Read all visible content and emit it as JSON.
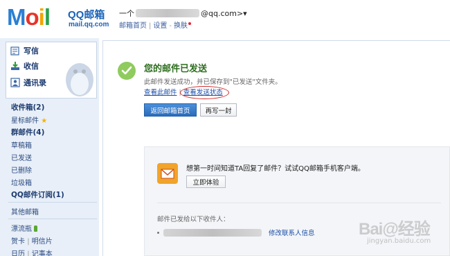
{
  "header": {
    "logo_brand": "QQ邮箱",
    "logo_url": "mail.qq.com",
    "user_prefix": "一个",
    "user_suffix": "@qq.com>▾",
    "links": [
      "邮箱首页",
      "设置",
      "换肤"
    ]
  },
  "sidebar": {
    "actions": [
      {
        "label": "写信",
        "icon": "compose-icon"
      },
      {
        "label": "收信",
        "icon": "inbox-download-icon"
      },
      {
        "label": "通讯录",
        "icon": "contacts-icon"
      }
    ],
    "folders": [
      {
        "label": "收件箱(2)",
        "bold": true
      },
      {
        "label": "星标邮件",
        "bold": false
      },
      {
        "label": "群邮件(4)",
        "bold": true
      },
      {
        "label": "草稿箱",
        "bold": false
      },
      {
        "label": "已发送",
        "bold": false
      },
      {
        "label": "已删除",
        "bold": false
      },
      {
        "label": "垃圾箱",
        "bold": false
      },
      {
        "label": "QQ邮件订阅(1)",
        "bold": true
      }
    ],
    "other_mailbox": "其他邮箱",
    "drift_bottle": "漂流瓶",
    "card": "贺卡",
    "postcard": "明信片",
    "calendar": "日历",
    "notebook": "记事本"
  },
  "main": {
    "title": "您的邮件已发送",
    "desc": "此邮件发送成功，并已保存到\"已发送\"文件夹。",
    "view_link": "查看此邮件",
    "status_link": "查看发送状态",
    "back_button": "返回邮箱首页",
    "write_again_button": "再写一封",
    "promo_text": "想第一时间知道TA回复了邮件？试试QQ邮箱手机客户端。",
    "try_button": "立即体验",
    "recipients_label": "邮件已发给以下收件人：",
    "edit_contact": "修改联系人信息"
  },
  "watermark": {
    "brand": "Bai@经验",
    "url": "jingyan.baidu.com"
  },
  "colors": {
    "accent_blue": "#2a6cbd",
    "success_green": "#2c6e1d",
    "highlight_red": "#d12a2a",
    "sidebar_bg": "#e8eff8"
  }
}
